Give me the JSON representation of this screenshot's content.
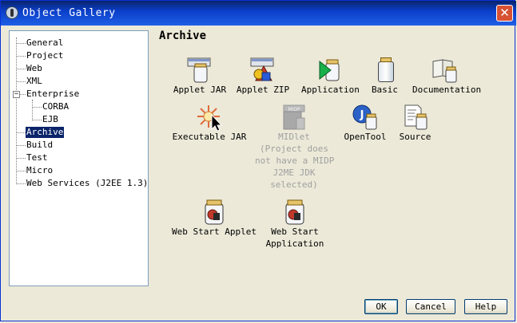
{
  "window": {
    "title": "Object Gallery",
    "close_glyph": "✕"
  },
  "tree": {
    "items": [
      {
        "label": "General"
      },
      {
        "label": "Project"
      },
      {
        "label": "Web"
      },
      {
        "label": "XML"
      },
      {
        "label": "Enterprise",
        "expanded": true
      },
      {
        "label": "CORBA"
      },
      {
        "label": "EJB"
      },
      {
        "label": "Archive",
        "selected": true
      },
      {
        "label": "Build"
      },
      {
        "label": "Test"
      },
      {
        "label": "Micro"
      },
      {
        "label": "Web Services (J2EE 1.3)"
      }
    ],
    "expander_glyph": "−"
  },
  "main": {
    "title": "Archive",
    "items": [
      {
        "label": "Applet JAR",
        "icon": "applet-jar-icon"
      },
      {
        "label": "Applet ZIP",
        "icon": "applet-zip-icon"
      },
      {
        "label": "Application",
        "icon": "application-icon"
      },
      {
        "label": "Basic",
        "icon": "basic-jar-icon"
      },
      {
        "label": "Documentation",
        "icon": "documentation-icon"
      },
      {
        "label": "Executable JAR",
        "icon": "executable-jar-icon"
      },
      {
        "label": "MIDlet",
        "icon": "midlet-icon",
        "disabled": true,
        "note_lines": [
          "(Project does",
          "not have a MIDP",
          "J2ME JDK",
          "selected)"
        ]
      },
      {
        "label": "OpenTool",
        "icon": "opentool-icon"
      },
      {
        "label": "Source",
        "icon": "source-icon"
      },
      {
        "label": "Web Start Applet",
        "icon": "web-start-applet-icon"
      },
      {
        "label_lines": [
          "Web Start",
          "Application"
        ],
        "icon": "web-start-application-icon"
      }
    ],
    "midp_badge": "MIDP",
    "opentool_badge": "J"
  },
  "buttons": {
    "ok": "OK",
    "cancel": "Cancel",
    "help": "Help"
  }
}
